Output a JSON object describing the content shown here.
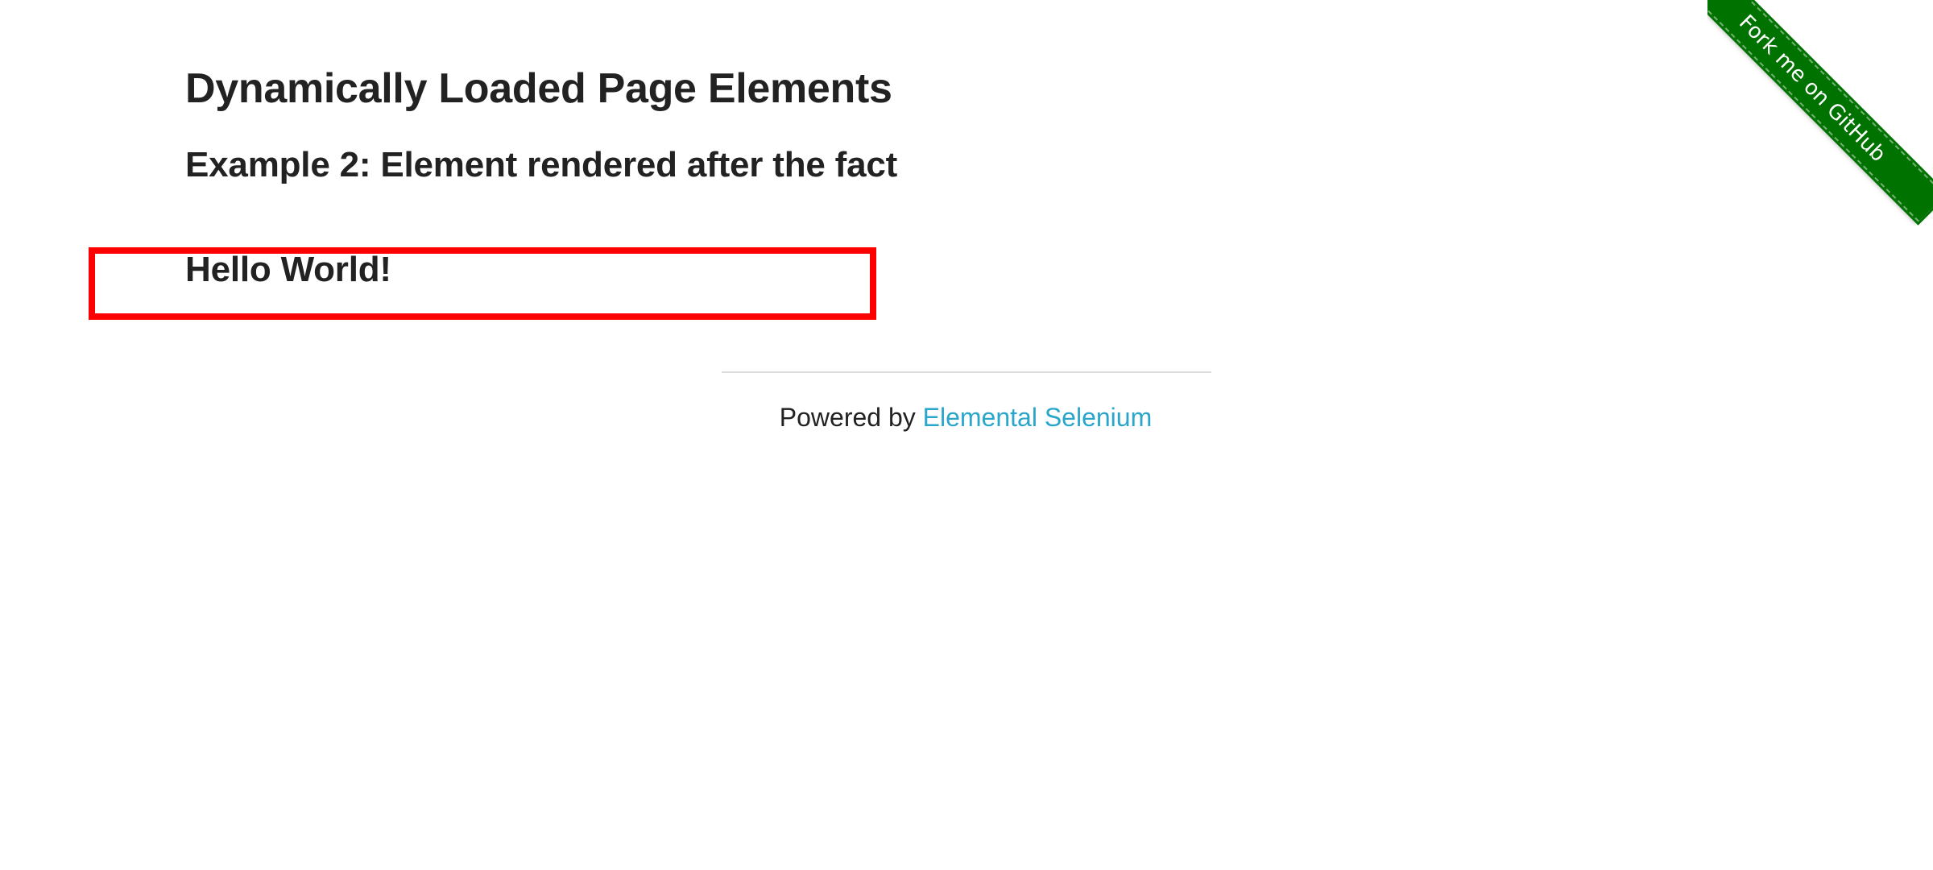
{
  "page": {
    "title": "Dynamically Loaded Page Elements",
    "example_title": "Example 2: Element rendered after the fact",
    "finish_text": "Hello World!"
  },
  "footer": {
    "powered_by": "Powered by",
    "link_label": "Elemental Selenium"
  },
  "ribbon": {
    "label": "Fork me on GitHub"
  },
  "colors": {
    "text": "#222222",
    "link": "#2ba6cb",
    "ribbon": "#007200",
    "highlight_box": "#ff0000",
    "rule": "#dddddd"
  }
}
